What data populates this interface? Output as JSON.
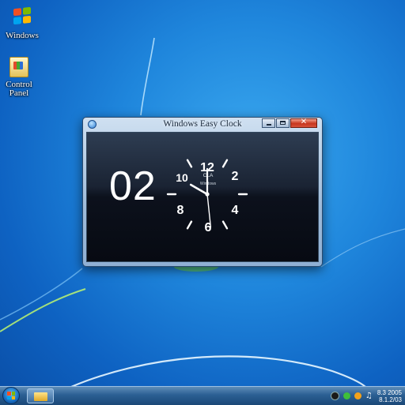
{
  "desktop": {
    "icons": [
      {
        "label": "Windows"
      },
      {
        "label_lines": [
          "Control",
          "Panel"
        ]
      }
    ]
  },
  "window": {
    "title": "Windows Easy Clock",
    "buttons": {
      "close_glyph": "✕"
    },
    "clock": {
      "digital_display": "02",
      "dial_numbers": [
        "12",
        "2",
        "4",
        "6",
        "8",
        "10"
      ],
      "dial_caption_lines": [
        "CLA",
        "Windows"
      ],
      "hands": {
        "hour": 10,
        "minute": 0,
        "second": 29
      }
    }
  },
  "taskbar": {
    "tray_clock_lines": [
      "8.3 2005",
      "8.1.2/03"
    ]
  },
  "colors": {
    "desktop_blue": "#1f86dc",
    "window_frame": "#9fbbd9",
    "close_red": "#c7361e",
    "clock_face": "#0c111c",
    "windows_logo": [
      "#f25022",
      "#7fba00",
      "#00a4ef",
      "#ffb900"
    ]
  },
  "icons": [
    "windows-logo-icon",
    "control-panel-icon",
    "clock-app-icon",
    "minimize-icon",
    "maximize-icon",
    "close-icon",
    "start-orb-icon",
    "folder-icon",
    "shield-icon",
    "network-icon",
    "globe-icon",
    "volume-icon"
  ]
}
